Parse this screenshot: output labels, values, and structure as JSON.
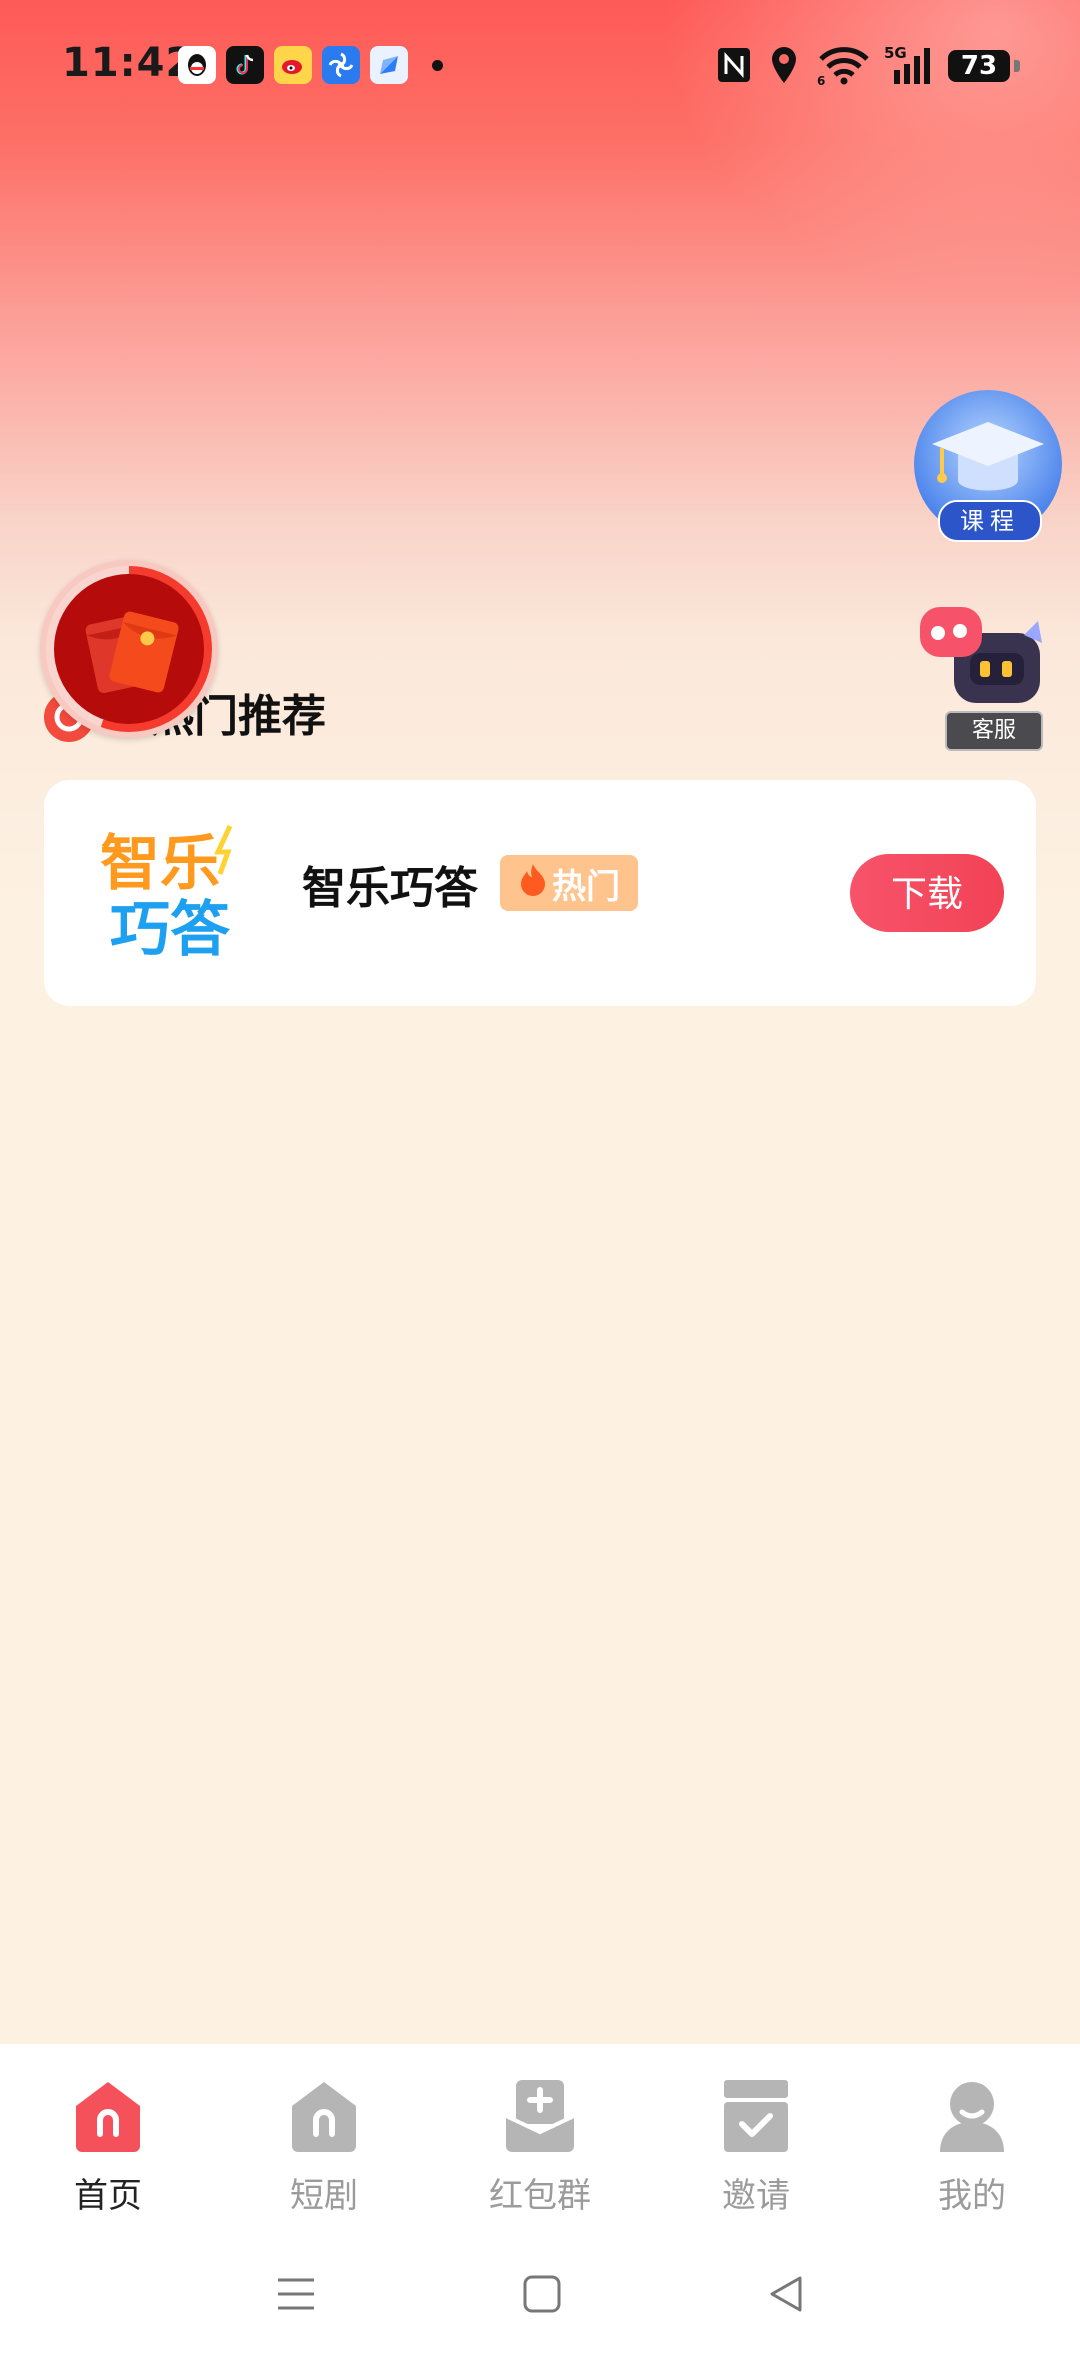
{
  "status_bar": {
    "time": "11:42",
    "battery": "73",
    "network": "5G",
    "icons": [
      "qq-icon",
      "tiktok-icon",
      "weibo-icon",
      "pinwheel-icon",
      "browser-icon",
      "nfc-icon",
      "location-icon",
      "wifi-icon",
      "signal-icon",
      "battery-icon"
    ]
  },
  "floating": {
    "course_label": "课程",
    "service_label": "客服"
  },
  "section": {
    "title": "热门推荐"
  },
  "app_card": {
    "name": "智乐巧答",
    "logo_text_top": "智乐",
    "logo_text_bottom": "巧答",
    "tag": "热门",
    "download_label": "下载"
  },
  "bottom_nav": {
    "items": [
      {
        "label": "首页",
        "active": true
      },
      {
        "label": "短剧",
        "active": false
      },
      {
        "label": "红包群",
        "active": false
      },
      {
        "label": "邀请",
        "active": false
      },
      {
        "label": "我的",
        "active": false
      }
    ]
  },
  "colors": {
    "accent": "#f24256",
    "hot_tag": "#ffc48e",
    "nav_active_icon": "#f4515a",
    "nav_inactive_icon": "#b5b5b5"
  }
}
